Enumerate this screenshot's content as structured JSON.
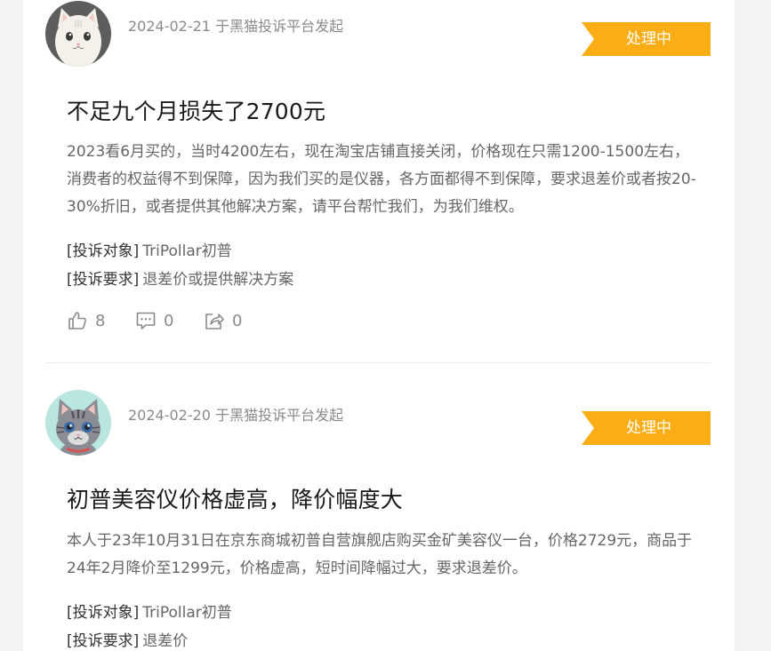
{
  "complaints": [
    {
      "meta": "2024-02-21 于黑猫投诉平台发起",
      "status": "处理中",
      "title": "不足九个月损失了2700元",
      "content": "2023看6月买的，当时4200左右，现在淘宝店铺直接关闭，价格现在只需1200-1500左右，消费者的权益得不到保障，因为我们买的是仪器，各方面都得不到保障，要求退差价或者按20-30%折旧，或者提供其他解决方案，请平台帮忙我们，为我们维权。",
      "target_label": "[投诉对象]",
      "target_value": "TriPollar初普",
      "demand_label": "[投诉要求]",
      "demand_value": "退差价或提供解决方案",
      "likes": "8",
      "comments": "0",
      "shares": "0",
      "avatar_icon": "white-cat-avatar-icon"
    },
    {
      "meta": "2024-02-20 于黑猫投诉平台发起",
      "status": "处理中",
      "title": "初普美容仪价格虚高，降价幅度大",
      "content": "本人于23年10月31日在京东商城初普自营旗舰店购买金矿美容仪一台，价格2729元，商品于24年2月降价至1299元，价格虚高，短时间降幅过大，要求退差价。",
      "target_label": "[投诉对象]",
      "target_value": "TriPollar初普",
      "demand_label": "[投诉要求]",
      "demand_value": "退差价",
      "avatar_icon": "gray-tabby-cat-avatar-icon"
    }
  ],
  "colors": {
    "status_bg": "#fbad16",
    "meta_text": "#8a8a8a",
    "title_text": "#1a1a1a",
    "body_text": "#666666"
  }
}
